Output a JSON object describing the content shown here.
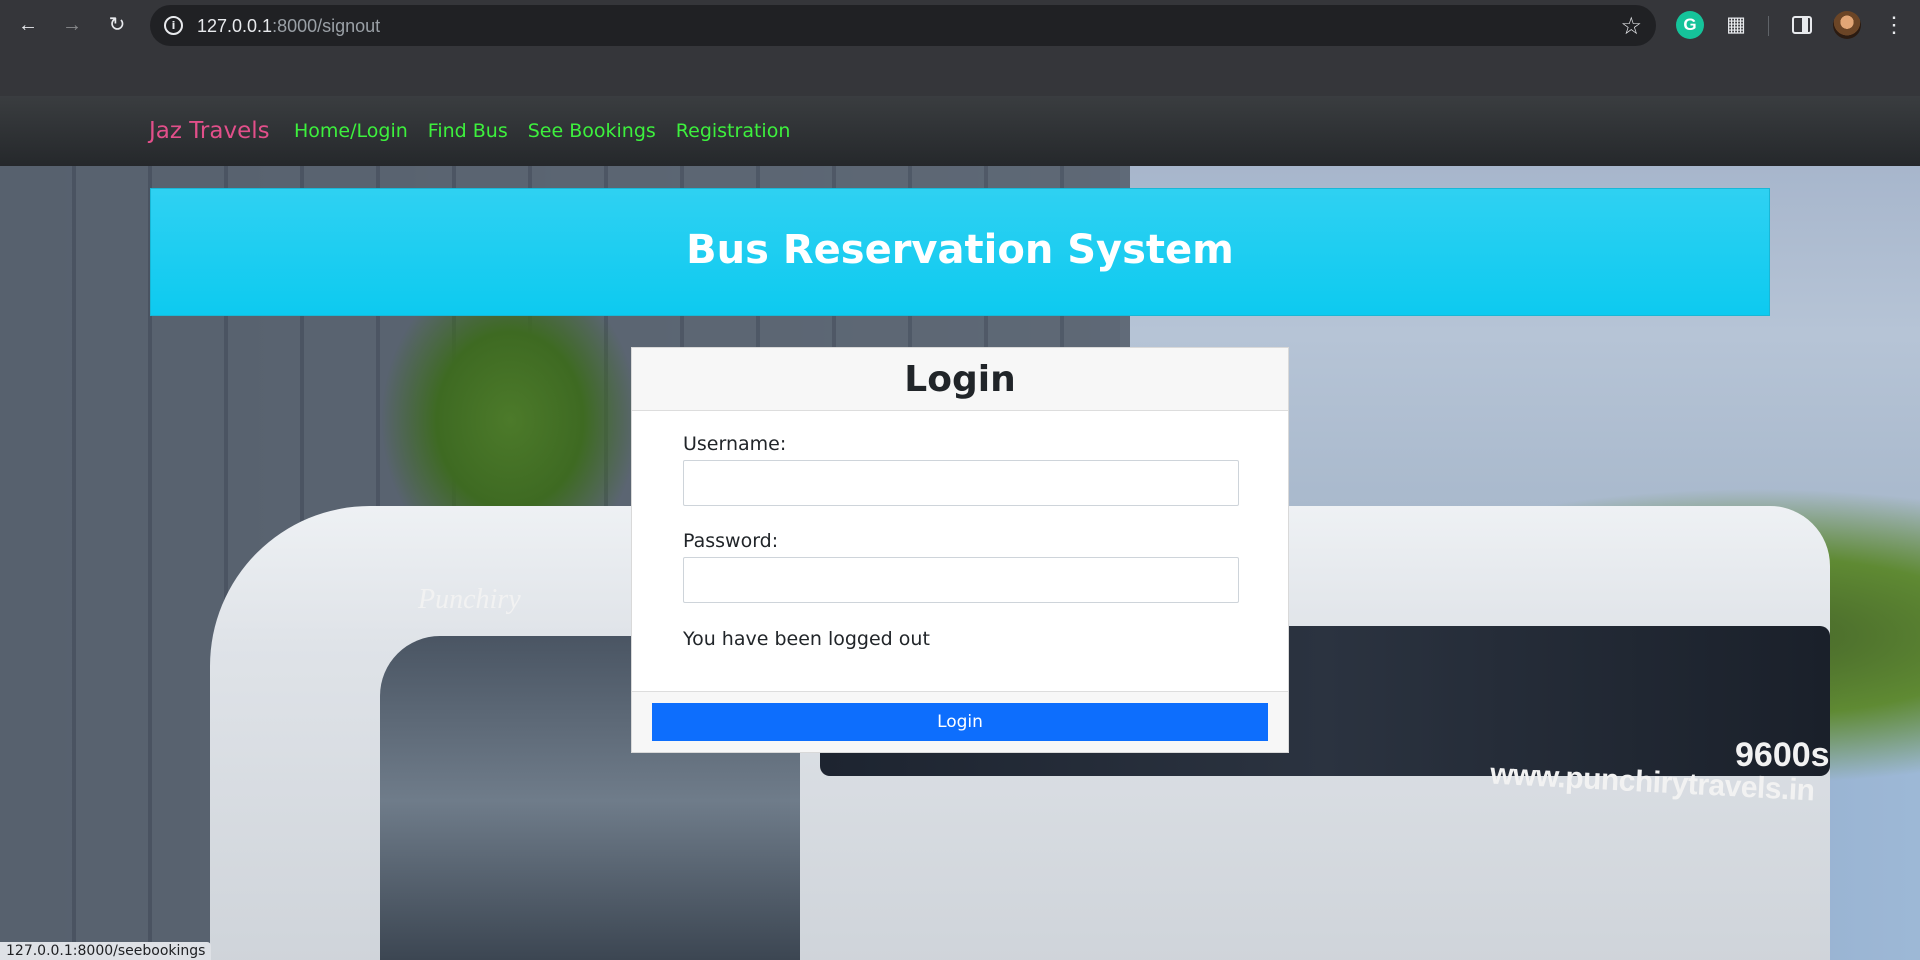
{
  "browser": {
    "url_host": "127.0.0.1",
    "url_path": ":8000/signout",
    "status_url": "127.0.0.1:8000/seebookings",
    "grammarly_letter": "G",
    "icons": [
      "back-icon",
      "forward-icon",
      "reload-icon",
      "site-info-icon",
      "bookmark-star-icon",
      "grammarly-icon",
      "extensions-icon",
      "side-panel-icon",
      "profile-avatar",
      "more-menu-icon"
    ]
  },
  "navbar": {
    "brand": "Jaz Travels",
    "links": [
      "Home/Login",
      "Find Bus",
      "See Bookings",
      "Registration"
    ],
    "brand_color": "#e24f8a",
    "link_color": "#3df03d"
  },
  "hero": {
    "title": "Bus Reservation System",
    "color": "#0dcaf0"
  },
  "background": {
    "bus_brand_text": "www.punchirytravels.in",
    "bus_model_text": "9600s",
    "bus_logo_text": "Punchiry"
  },
  "login": {
    "title": "Login",
    "username_label": "Username:",
    "username_value": "",
    "password_label": "Password:",
    "password_value": "",
    "message": "You have been logged out",
    "button_label": "Login",
    "button_color": "#0d6efd"
  }
}
